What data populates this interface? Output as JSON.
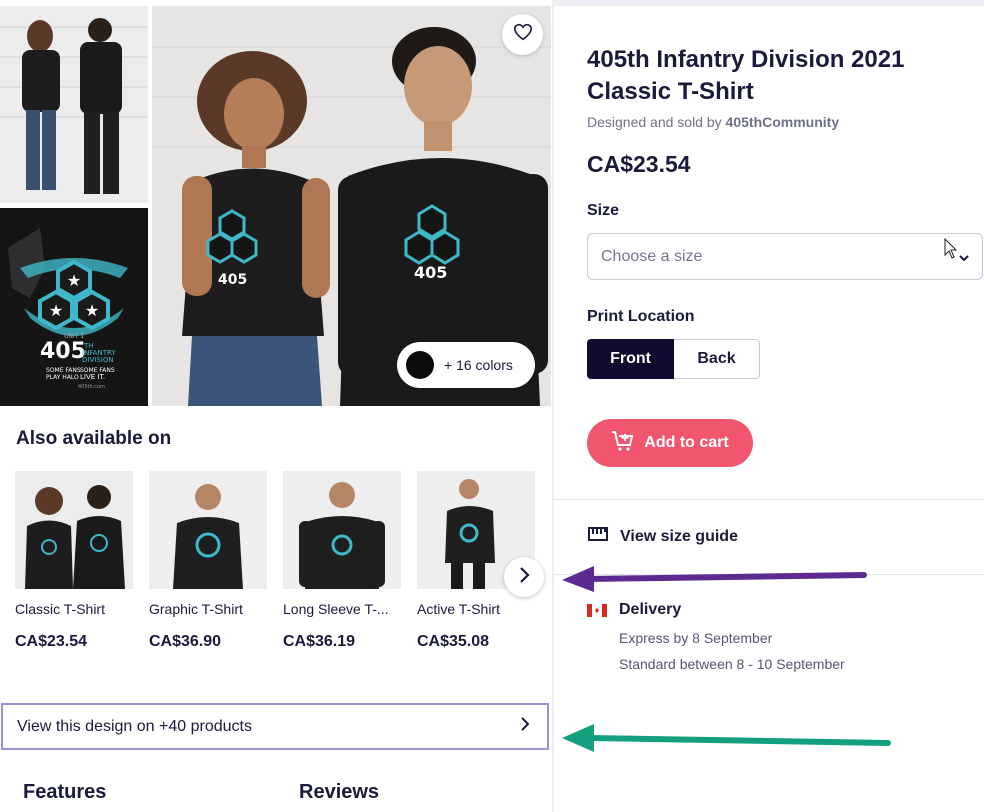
{
  "product": {
    "title": "405th Infantry Division 2021 Classic T-Shirt",
    "sold_by_prefix": "Designed and sold by ",
    "sold_by_artist": "405thCommunity",
    "price": "CA$23.54"
  },
  "gallery": {
    "colors_label": "+ 16 colors",
    "favorite_icon": "heart-icon",
    "design_text": {
      "big": "405",
      "sup": "TH",
      "line1": "INFANTRY",
      "line2": "DIVISION",
      "left_tag1": "SOME FANS",
      "left_tag2": "PLAY HALO",
      "right_tag1": "SOME FANS",
      "right_tag2": "LIVE IT.",
      "site": "405th.com",
      "unit": "UNIT 1"
    }
  },
  "options": {
    "size_label": "Size",
    "size_placeholder": "Choose a size",
    "print_location_label": "Print Location",
    "front_label": "Front",
    "back_label": "Back"
  },
  "cart": {
    "add_to_cart_label": "Add to cart"
  },
  "size_guide": {
    "label": "View size guide"
  },
  "delivery": {
    "title": "Delivery",
    "express": "Express by 8 September",
    "standard": "Standard between 8 - 10 September"
  },
  "also_available": {
    "title": "Also available on",
    "products": [
      {
        "name": "Classic T-Shirt",
        "price": "CA$23.54"
      },
      {
        "name": "Graphic T-Shirt",
        "price": "CA$36.90"
      },
      {
        "name": "Long Sleeve T-...",
        "price": "CA$36.19"
      },
      {
        "name": "Active T-Shirt",
        "price": "CA$35.08"
      }
    ]
  },
  "view_design": {
    "label": "View this design on +40 products"
  },
  "sections": {
    "features": "Features",
    "reviews": "Reviews"
  },
  "colors": {
    "accent_pink": "#f2566e",
    "navy": "#120a2e",
    "teal_design": "#3fb8c9",
    "arrow_purple": "#5d2a8f",
    "arrow_green": "#13a07f",
    "highlight_border": "#9d92d6"
  }
}
